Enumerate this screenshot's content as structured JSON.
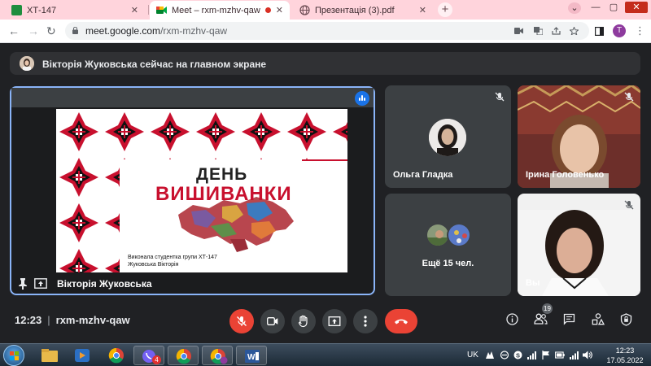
{
  "browser": {
    "tabs": [
      {
        "title": "ХТ-147",
        "active": false
      },
      {
        "title": "Meet – rxm-mzhv-qaw",
        "active": true
      },
      {
        "title": "Презентація (3).pdf",
        "active": false
      }
    ],
    "url_host": "meet.google.com",
    "url_path": "/rxm-mzhv-qaw",
    "profile_initial": "T"
  },
  "meet": {
    "presenting_banner": "Вікторія Жуковська сейчас на главном экране",
    "main_tile": {
      "presenter_name": "Вікторія Жуковська",
      "slide_title_line1": "ДЕНЬ",
      "slide_title_line2": "ВИШИВАНКИ",
      "slide_caption_line1": "Виконала студентка групи ХТ-147",
      "slide_caption_line2": "Жуковська Вікторія"
    },
    "participants": [
      {
        "name": "Ольга Гладка",
        "muted": true
      },
      {
        "name": "Ірина Головенько",
        "muted": true
      },
      {
        "name": "Ещё 15 чел.",
        "muted": false
      },
      {
        "name": "Вы",
        "muted": true
      }
    ],
    "time": "12:23",
    "meeting_code": "rxm-mzhv-qaw",
    "participant_count": "19"
  },
  "taskbar": {
    "language": "UK",
    "clock_time": "12:23",
    "clock_date": "17.05.2022",
    "viber_badge": "4"
  },
  "colors": {
    "accent_blue": "#8ab4f8",
    "end_call_red": "#ea4335",
    "tab_strip_pink": "#ffd4dc",
    "slide_red": "#c8102e"
  }
}
